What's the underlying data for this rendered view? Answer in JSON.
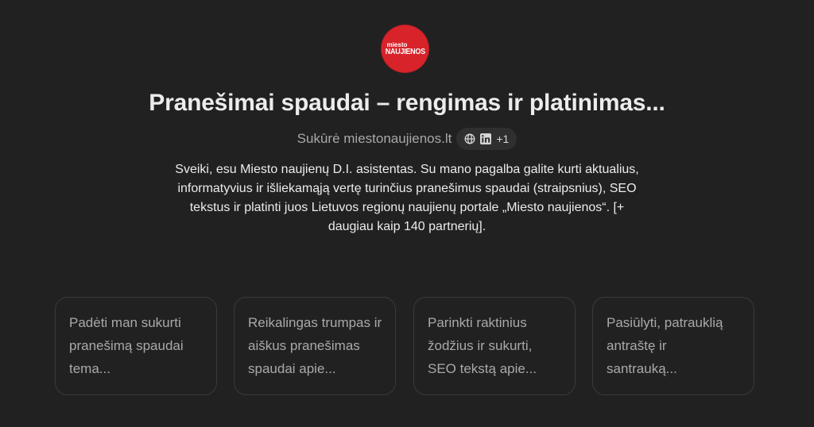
{
  "logo": {
    "line1": "miesto",
    "line2": "NAUJIENOS",
    "background": "#d8232a"
  },
  "gpt": {
    "title": "Pranešimai spaudai – rengimas ir platinimas...",
    "author": "Sukūrė miestonaujienos.lt",
    "social": {
      "icons": [
        "globe-icon",
        "linkedin-icon"
      ],
      "extra": "+1"
    },
    "description": "Sveiki, esu Miesto naujienų D.I. asistentas. Su mano pagalba galite kurti aktualius, informatyvius ir išliekamąją vertę turinčius pranešimus spaudai (straipsnius), SEO tekstus ir platinti juos Lietuvos regionų naujienų portale „Miesto naujienos“. [+ daugiau kaip 140 partnerių]."
  },
  "starters": [
    {
      "text": "Padėti man sukurti pranešimą spaudai tema..."
    },
    {
      "text": "Reikalingas trumpas ir aiškus pranešimas spaudai apie..."
    },
    {
      "text": "Parinkti raktinius žodžius ir sukurti, SEO tekstą apie..."
    },
    {
      "text": "Pasiūlyti, patrauklią antraštę ir santrauką..."
    }
  ],
  "colors": {
    "background": "#212121",
    "card_border": "#3a3a3a",
    "pill_background": "#2f2f2f",
    "muted_text": "#a8a8a8"
  }
}
